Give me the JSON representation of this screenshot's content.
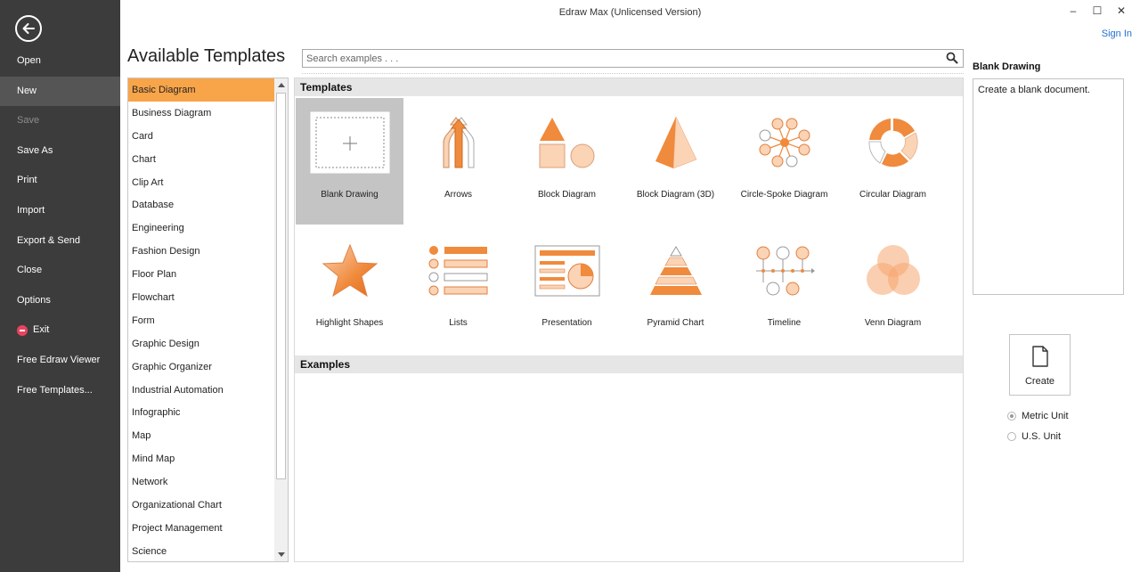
{
  "window": {
    "title": "Edraw Max (Unlicensed Version)",
    "minimize": "–",
    "maximize": "☐",
    "close": "✕",
    "sign_in": "Sign In"
  },
  "sidebar": {
    "items": [
      {
        "label": "Open"
      },
      {
        "label": "New"
      },
      {
        "label": "Save"
      },
      {
        "label": "Save As"
      },
      {
        "label": "Print"
      },
      {
        "label": "Import"
      },
      {
        "label": "Export & Send"
      },
      {
        "label": "Close"
      },
      {
        "label": "Options"
      },
      {
        "label": "Exit"
      },
      {
        "label": "Free Edraw Viewer"
      },
      {
        "label": "Free Templates..."
      }
    ]
  },
  "page_title": "Available Templates",
  "search": {
    "placeholder": "Search examples . . ."
  },
  "categories": [
    "Basic Diagram",
    "Business Diagram",
    "Card",
    "Chart",
    "Clip Art",
    "Database",
    "Engineering",
    "Fashion Design",
    "Floor Plan",
    "Flowchart",
    "Form",
    "Graphic Design",
    "Graphic Organizer",
    "Industrial Automation",
    "Infographic",
    "Map",
    "Mind Map",
    "Network",
    "Organizational Chart",
    "Project Management",
    "Science"
  ],
  "templates_header": "Templates",
  "examples_header": "Examples",
  "templates": [
    {
      "label": "Blank Drawing",
      "icon": "blank-drawing-icon"
    },
    {
      "label": "Arrows",
      "icon": "arrows-icon"
    },
    {
      "label": "Block Diagram",
      "icon": "block-diagram-icon"
    },
    {
      "label": "Block Diagram (3D)",
      "icon": "pyramid-3d-icon"
    },
    {
      "label": "Circle-Spoke Diagram",
      "icon": "circle-spoke-icon"
    },
    {
      "label": "Circular Diagram",
      "icon": "circular-diagram-icon"
    },
    {
      "label": "Highlight Shapes",
      "icon": "star-icon"
    },
    {
      "label": "Lists",
      "icon": "list-icon"
    },
    {
      "label": "Presentation",
      "icon": "presentation-icon"
    },
    {
      "label": "Pyramid Chart",
      "icon": "pyramid-chart-icon"
    },
    {
      "label": "Timeline",
      "icon": "timeline-icon"
    },
    {
      "label": "Venn Diagram",
      "icon": "venn-diagram-icon"
    }
  ],
  "preview": {
    "title": "Blank Drawing",
    "description": "Create a blank document."
  },
  "create_label": "Create",
  "units": {
    "metric": "Metric Unit",
    "us": "U.S. Unit"
  },
  "colors": {
    "accent": "#f8a54a",
    "sidebar_bg": "#3c3c3c",
    "icon_orange": "#f08a3c",
    "icon_light": "#fbd3b5"
  }
}
